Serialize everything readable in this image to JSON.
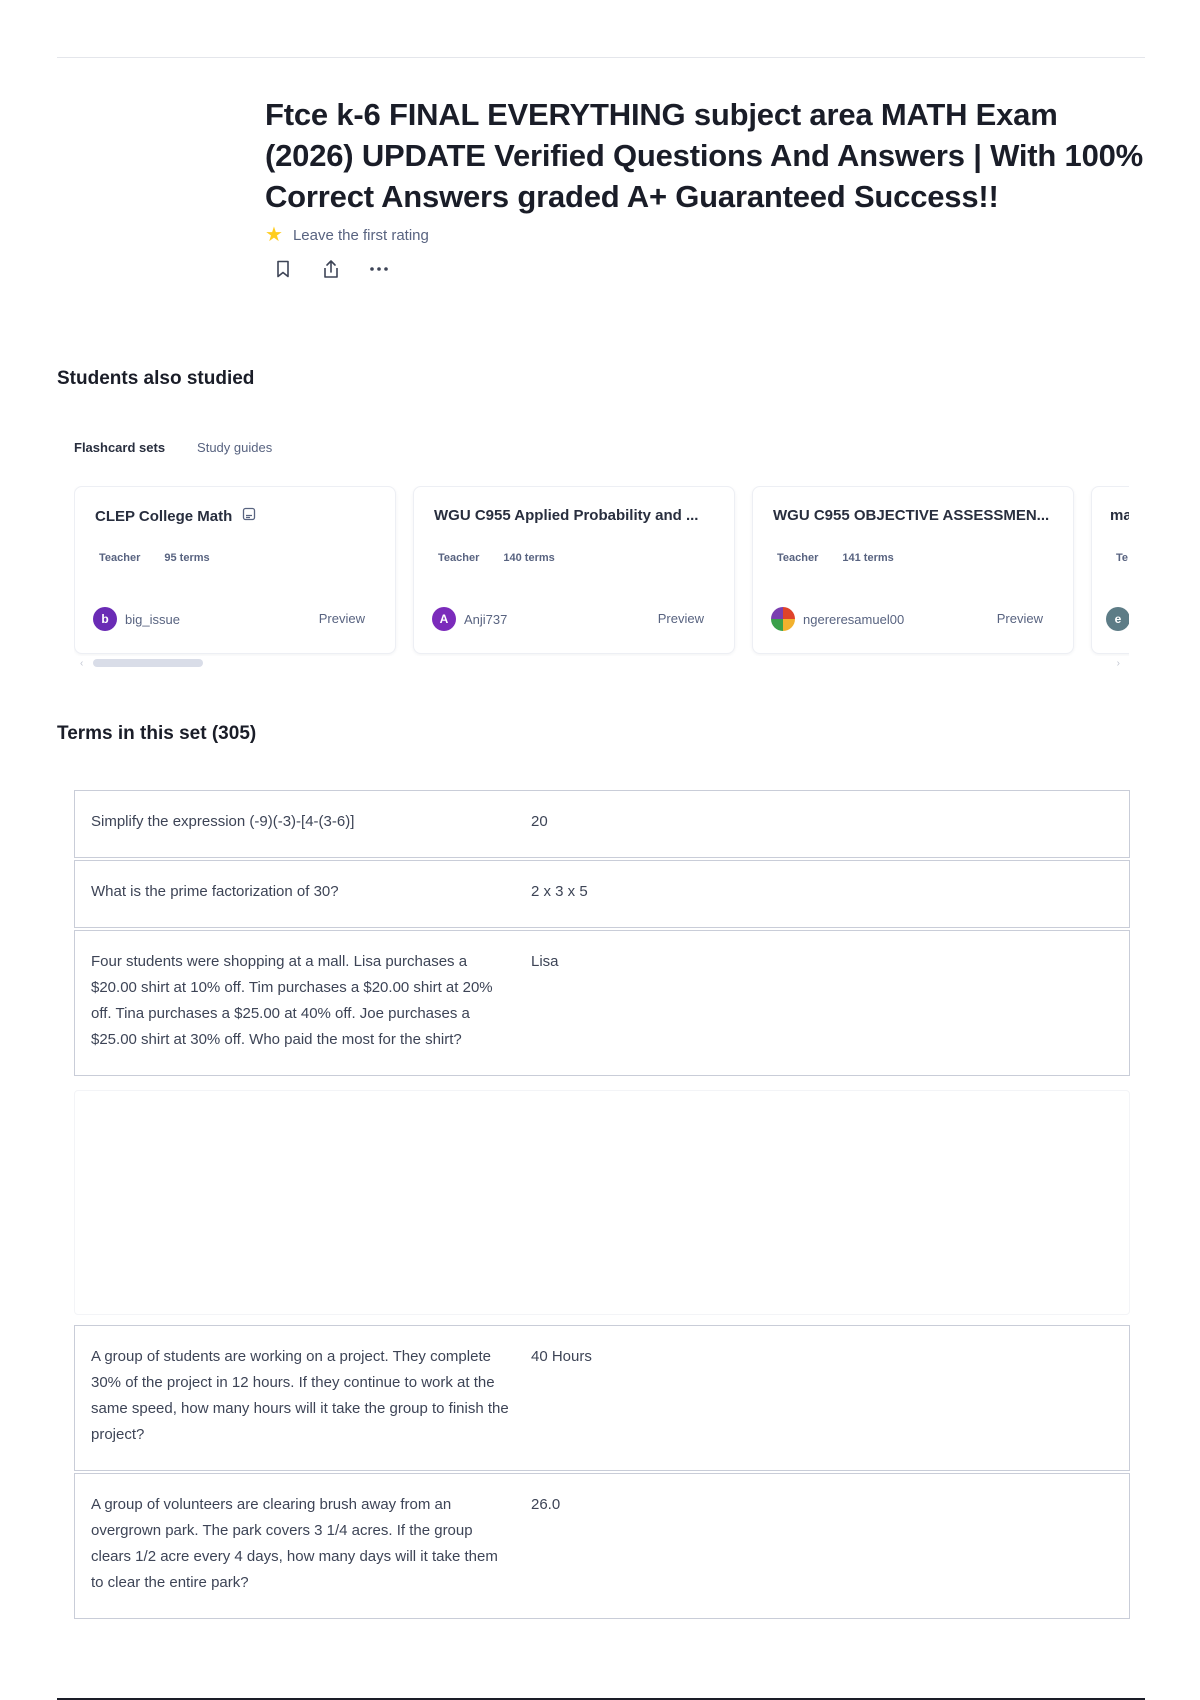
{
  "header": {
    "title": "Ftce k-6 FINAL EVERYTHING subject area MATH Exam (2026) UPDATE Verified Questions And Answers | With 100% Correct Answers graded A+ Guaranteed Success!!",
    "rating_text": "Leave the first rating"
  },
  "also_studied": {
    "heading": "Students also studied",
    "tabs": [
      {
        "label": "Flashcard sets"
      },
      {
        "label": "Study guides"
      }
    ],
    "cards": [
      {
        "title": "CLEP College Math",
        "role": "Teacher",
        "terms": "95 terms",
        "avatar_letter": "b",
        "avatar_color": "#6a2bb5",
        "author": "big_issue",
        "preview": "Preview"
      },
      {
        "title": "WGU C955 Applied Probability and ...",
        "role": "Teacher",
        "terms": "140 terms",
        "avatar_letter": "A",
        "avatar_color": "#7b2bbb",
        "author": "Anji737",
        "preview": "Preview"
      },
      {
        "title": "WGU C955 OBJECTIVE ASSESSMEN...",
        "role": "Teacher",
        "terms": "141 terms",
        "avatar_letter": "",
        "avatar_color": "#e08a2a",
        "author": "ngereresamuel00",
        "preview": "Preview"
      },
      {
        "title": "ma",
        "role": "Te",
        "terms": "",
        "avatar_letter": "e",
        "avatar_color": "#5d7c86",
        "author": "",
        "preview": ""
      }
    ]
  },
  "terms_section": {
    "heading": "Terms in this set (305)",
    "terms": [
      {
        "q": "Simplify the expression (-9)(-3)-[4-(3-6)]",
        "a": "20"
      },
      {
        "q": "What is the prime factorization of 30?",
        "a": "2 x 3 x 5"
      },
      {
        "q": "Four students were shopping at a mall. Lisa purchases a $20.00 shirt at 10% off. Tim purchases a $20.00 shirt at 20% off. Tina purchases a $25.00 at 40% off. Joe purchases a $25.00 shirt at 30% off. Who paid the most for the shirt?",
        "a": "Lisa"
      },
      {
        "q": "A group of students are working on a project. They complete 30% of the project in 12 hours. If they continue to work at the same speed, how many hours will it take the group to finish the project?",
        "a": "40 Hours"
      },
      {
        "q": "A group of volunteers are clearing brush away from an overgrown park. The park covers 3 1/4 acres. If the group clears 1/2 acre every 4 days, how many days will it take them to clear the entire park?",
        "a": "26.0"
      }
    ]
  },
  "icons": [
    "star-icon",
    "bookmark-icon",
    "share-icon",
    "more-icon",
    "study-guide-icon"
  ],
  "colors": {
    "accent_star": "#ffcd1f",
    "text_muted": "#586380",
    "border": "#c9cdd8"
  }
}
